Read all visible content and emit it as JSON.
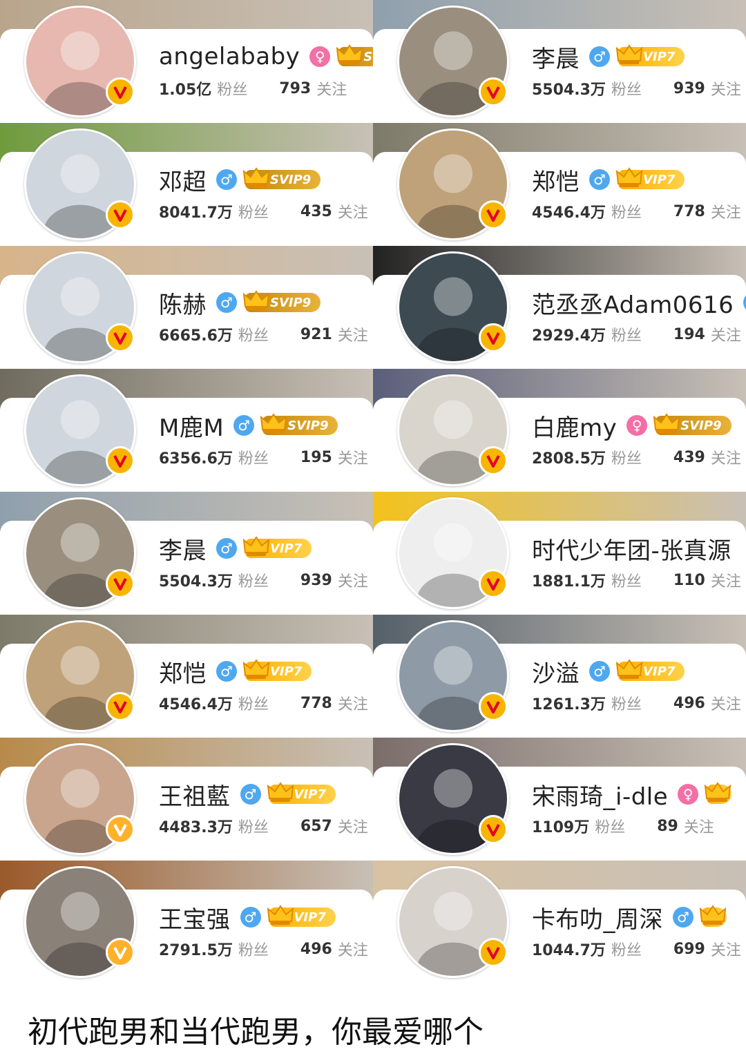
{
  "left": [
    {
      "name": "angelababy",
      "gender": "female",
      "vip": "SVIP",
      "followers": "1.05亿",
      "followers_label": "粉丝",
      "following": "793",
      "following_label": "关注",
      "banner": "#b9a58c",
      "avatar": "#e7b8b0",
      "badge": "V"
    },
    {
      "name": "邓超",
      "gender": "male",
      "vip": "SVIP9",
      "followers": "8041.7万",
      "followers_label": "粉丝",
      "following": "435",
      "following_label": "关注",
      "banner": "#6f9b3d",
      "avatar": "#cfd6dd",
      "badge": "V"
    },
    {
      "name": "陈赫",
      "gender": "male",
      "vip": "SVIP9",
      "followers": "6665.6万",
      "followers_label": "粉丝",
      "following": "921",
      "following_label": "关注",
      "banner": "#d8b48a",
      "avatar": "#cfd6dd",
      "badge": "V"
    },
    {
      "name": "M鹿M",
      "gender": "male",
      "vip": "SVIP9",
      "followers": "6356.6万",
      "followers_label": "粉丝",
      "following": "195",
      "following_label": "关注",
      "banner": "#6f6b5e",
      "avatar": "#cfd6dd",
      "badge": "V"
    },
    {
      "name": "李晨",
      "gender": "male",
      "vip": "VIP7",
      "followers": "5504.3万",
      "followers_label": "粉丝",
      "following": "939",
      "following_label": "关注",
      "banner": "#8fa0ad",
      "avatar": "#9a8f7f",
      "badge": "V"
    },
    {
      "name": "郑恺",
      "gender": "male",
      "vip": "VIP7",
      "followers": "4546.4万",
      "followers_label": "粉丝",
      "following": "778",
      "following_label": "关注",
      "banner": "#7d7a69",
      "avatar": "#bfa27a",
      "badge": "V"
    },
    {
      "name": "王祖藍",
      "gender": "male",
      "vip": "VIP7",
      "followers": "4483.3万",
      "followers_label": "粉丝",
      "following": "657",
      "following_label": "关注",
      "banner": "#b88a4a",
      "avatar": "#c9a58d",
      "badge": "orange"
    },
    {
      "name": "王宝强",
      "gender": "male",
      "vip": "VIP7",
      "followers": "2791.5万",
      "followers_label": "粉丝",
      "following": "496",
      "following_label": "关注",
      "banner": "#9a5a2a",
      "avatar": "#8a8178",
      "badge": "orange"
    }
  ],
  "right": [
    {
      "name": "李晨",
      "gender": "male",
      "vip": "VIP7",
      "followers": "5504.3万",
      "followers_label": "粉丝",
      "following": "939",
      "following_label": "关注",
      "banner": "#8fa0ad",
      "avatar": "#9a8f7f",
      "badge": "V"
    },
    {
      "name": "郑恺",
      "gender": "male",
      "vip": "VIP7",
      "followers": "4546.4万",
      "followers_label": "粉丝",
      "following": "778",
      "following_label": "关注",
      "banner": "#7d7a69",
      "avatar": "#bfa27a",
      "badge": "V"
    },
    {
      "name": "范丞丞Adam0616",
      "gender": "male",
      "vip": "",
      "followers": "2929.4万",
      "followers_label": "粉丝",
      "following": "194",
      "following_label": "关注",
      "banner": "#222222",
      "avatar": "#3d4a52",
      "badge": "V"
    },
    {
      "name": "白鹿my",
      "gender": "female",
      "vip": "SVIP9",
      "followers": "2808.5万",
      "followers_label": "粉丝",
      "following": "439",
      "following_label": "关注",
      "banner": "#5a5f7a",
      "avatar": "#d9d4cc",
      "badge": "V"
    },
    {
      "name": "时代少年团-张真源",
      "gender": "",
      "vip": "",
      "followers": "1881.1万",
      "followers_label": "粉丝",
      "following": "110",
      "following_label": "关注",
      "banner": "#f4c21c",
      "avatar": "#eeeeee",
      "badge": "V"
    },
    {
      "name": "沙溢",
      "gender": "male",
      "vip": "VIP7",
      "followers": "1261.3万",
      "followers_label": "粉丝",
      "following": "496",
      "following_label": "关注",
      "banner": "#55606a",
      "avatar": "#8e9aa6",
      "badge": "V"
    },
    {
      "name": "宋雨琦_i-dle",
      "gender": "female",
      "vip": "crown",
      "followers": "1109万",
      "followers_label": "粉丝",
      "following": "89",
      "following_label": "关注",
      "banner": "#7a6d6a",
      "avatar": "#3a3a44",
      "badge": "V"
    },
    {
      "name": "卡布叻_周深",
      "gender": "male",
      "vip": "crown",
      "followers": "1044.7万",
      "followers_label": "粉丝",
      "following": "699",
      "following_label": "关注",
      "banner": "#d8c2a2",
      "avatar": "#d8d2cc",
      "badge": "V"
    }
  ],
  "caption": "初代跑男和当代跑男，你最爱哪个",
  "colors": {
    "male": "#4fa8ee",
    "female": "#f36fa6",
    "vip": "#ffb000"
  }
}
